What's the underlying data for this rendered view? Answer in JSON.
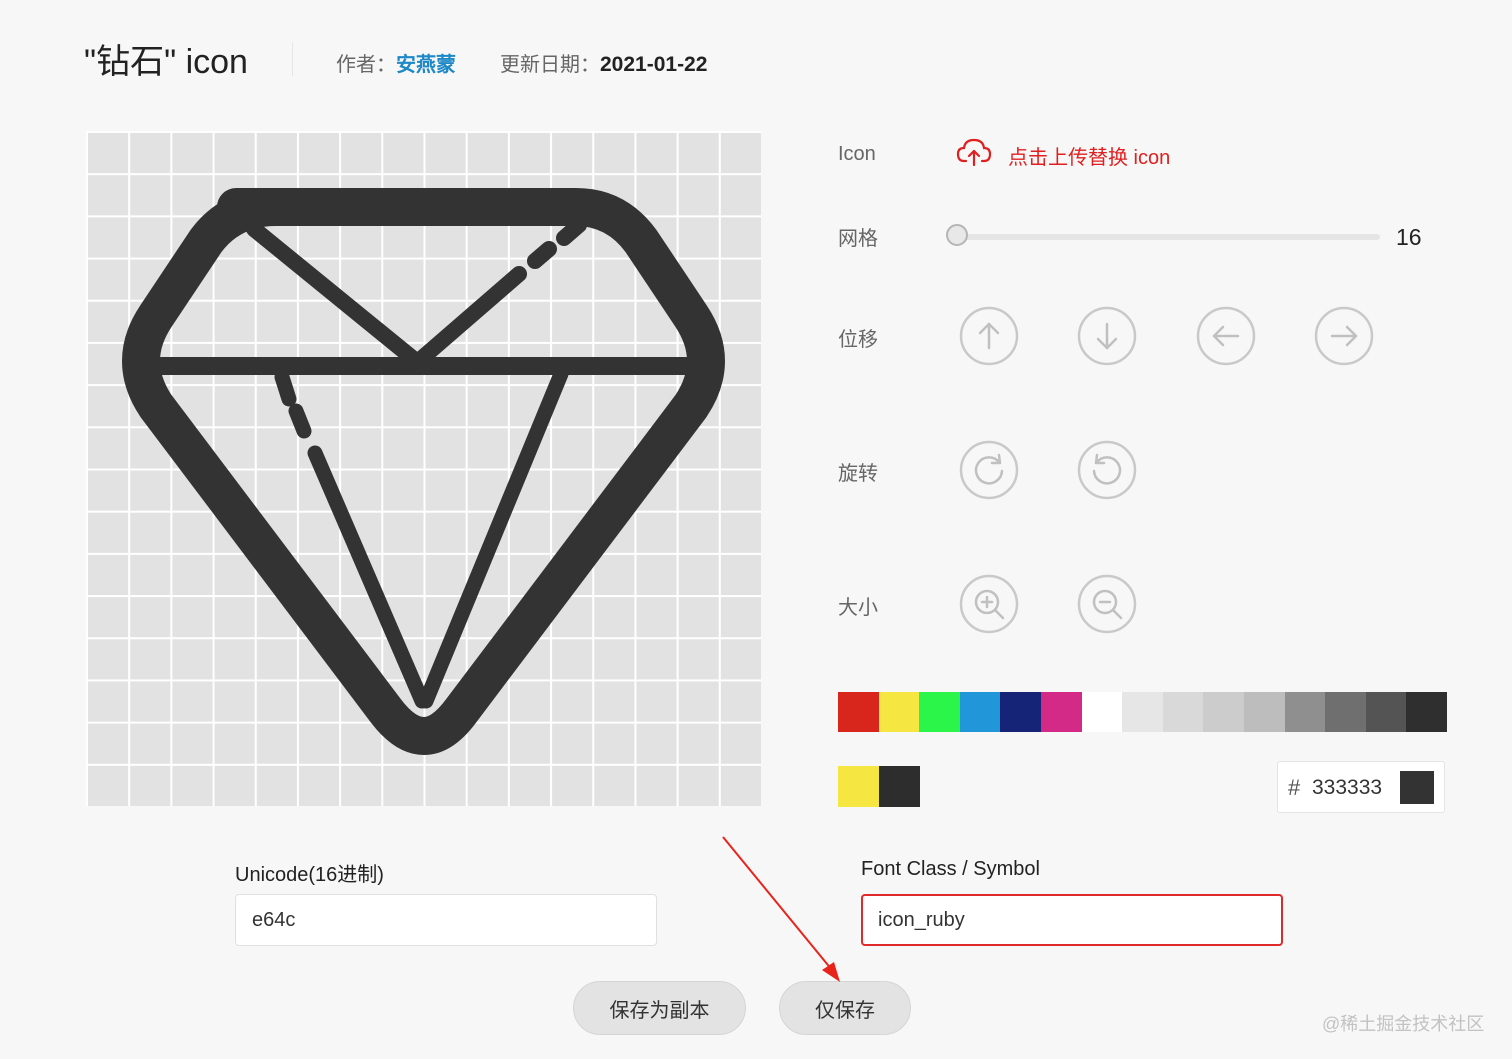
{
  "header": {
    "title": "\"钻石\"  icon",
    "author_label": "作者：",
    "author_name": "安燕蒙",
    "date_label": "更新日期：",
    "date_value": "2021-01-22"
  },
  "controls": {
    "icon_label": "Icon",
    "upload_label": "点击上传替换 icon",
    "grid_label": "网格",
    "grid_value": "16",
    "grid_min_fraction": 0,
    "shift_label": "位移",
    "rotate_label": "旋转",
    "size_label": "大小"
  },
  "palette": [
    "#d9261c",
    "#f5e642",
    "#2bf548",
    "#2196d9",
    "#162478",
    "#d22a86",
    "#ffffff",
    "#e6e6e6",
    "#d9d9d9",
    "#cccccc",
    "#bdbdbd",
    "#8f8f8f",
    "#6f6f6f",
    "#545454",
    "#2f2f2f"
  ],
  "recent_colors": [
    "#f5e642",
    "#2d2d2d"
  ],
  "color_input": {
    "hash": "#",
    "value": "333333",
    "preview_color": "#333333"
  },
  "icon_color": "#333333",
  "fields": {
    "unicode_label": "Unicode(16进制)",
    "unicode_value": "e64c",
    "font_class_label": "Font Class / Symbol",
    "font_class_value": "icon_ruby"
  },
  "buttons": {
    "save_copy": "保存为副本",
    "save_only": "仅保存"
  },
  "watermark": "@稀土掘金技术社区",
  "accent_color": "#e02020",
  "link_color": "#1e88c7"
}
